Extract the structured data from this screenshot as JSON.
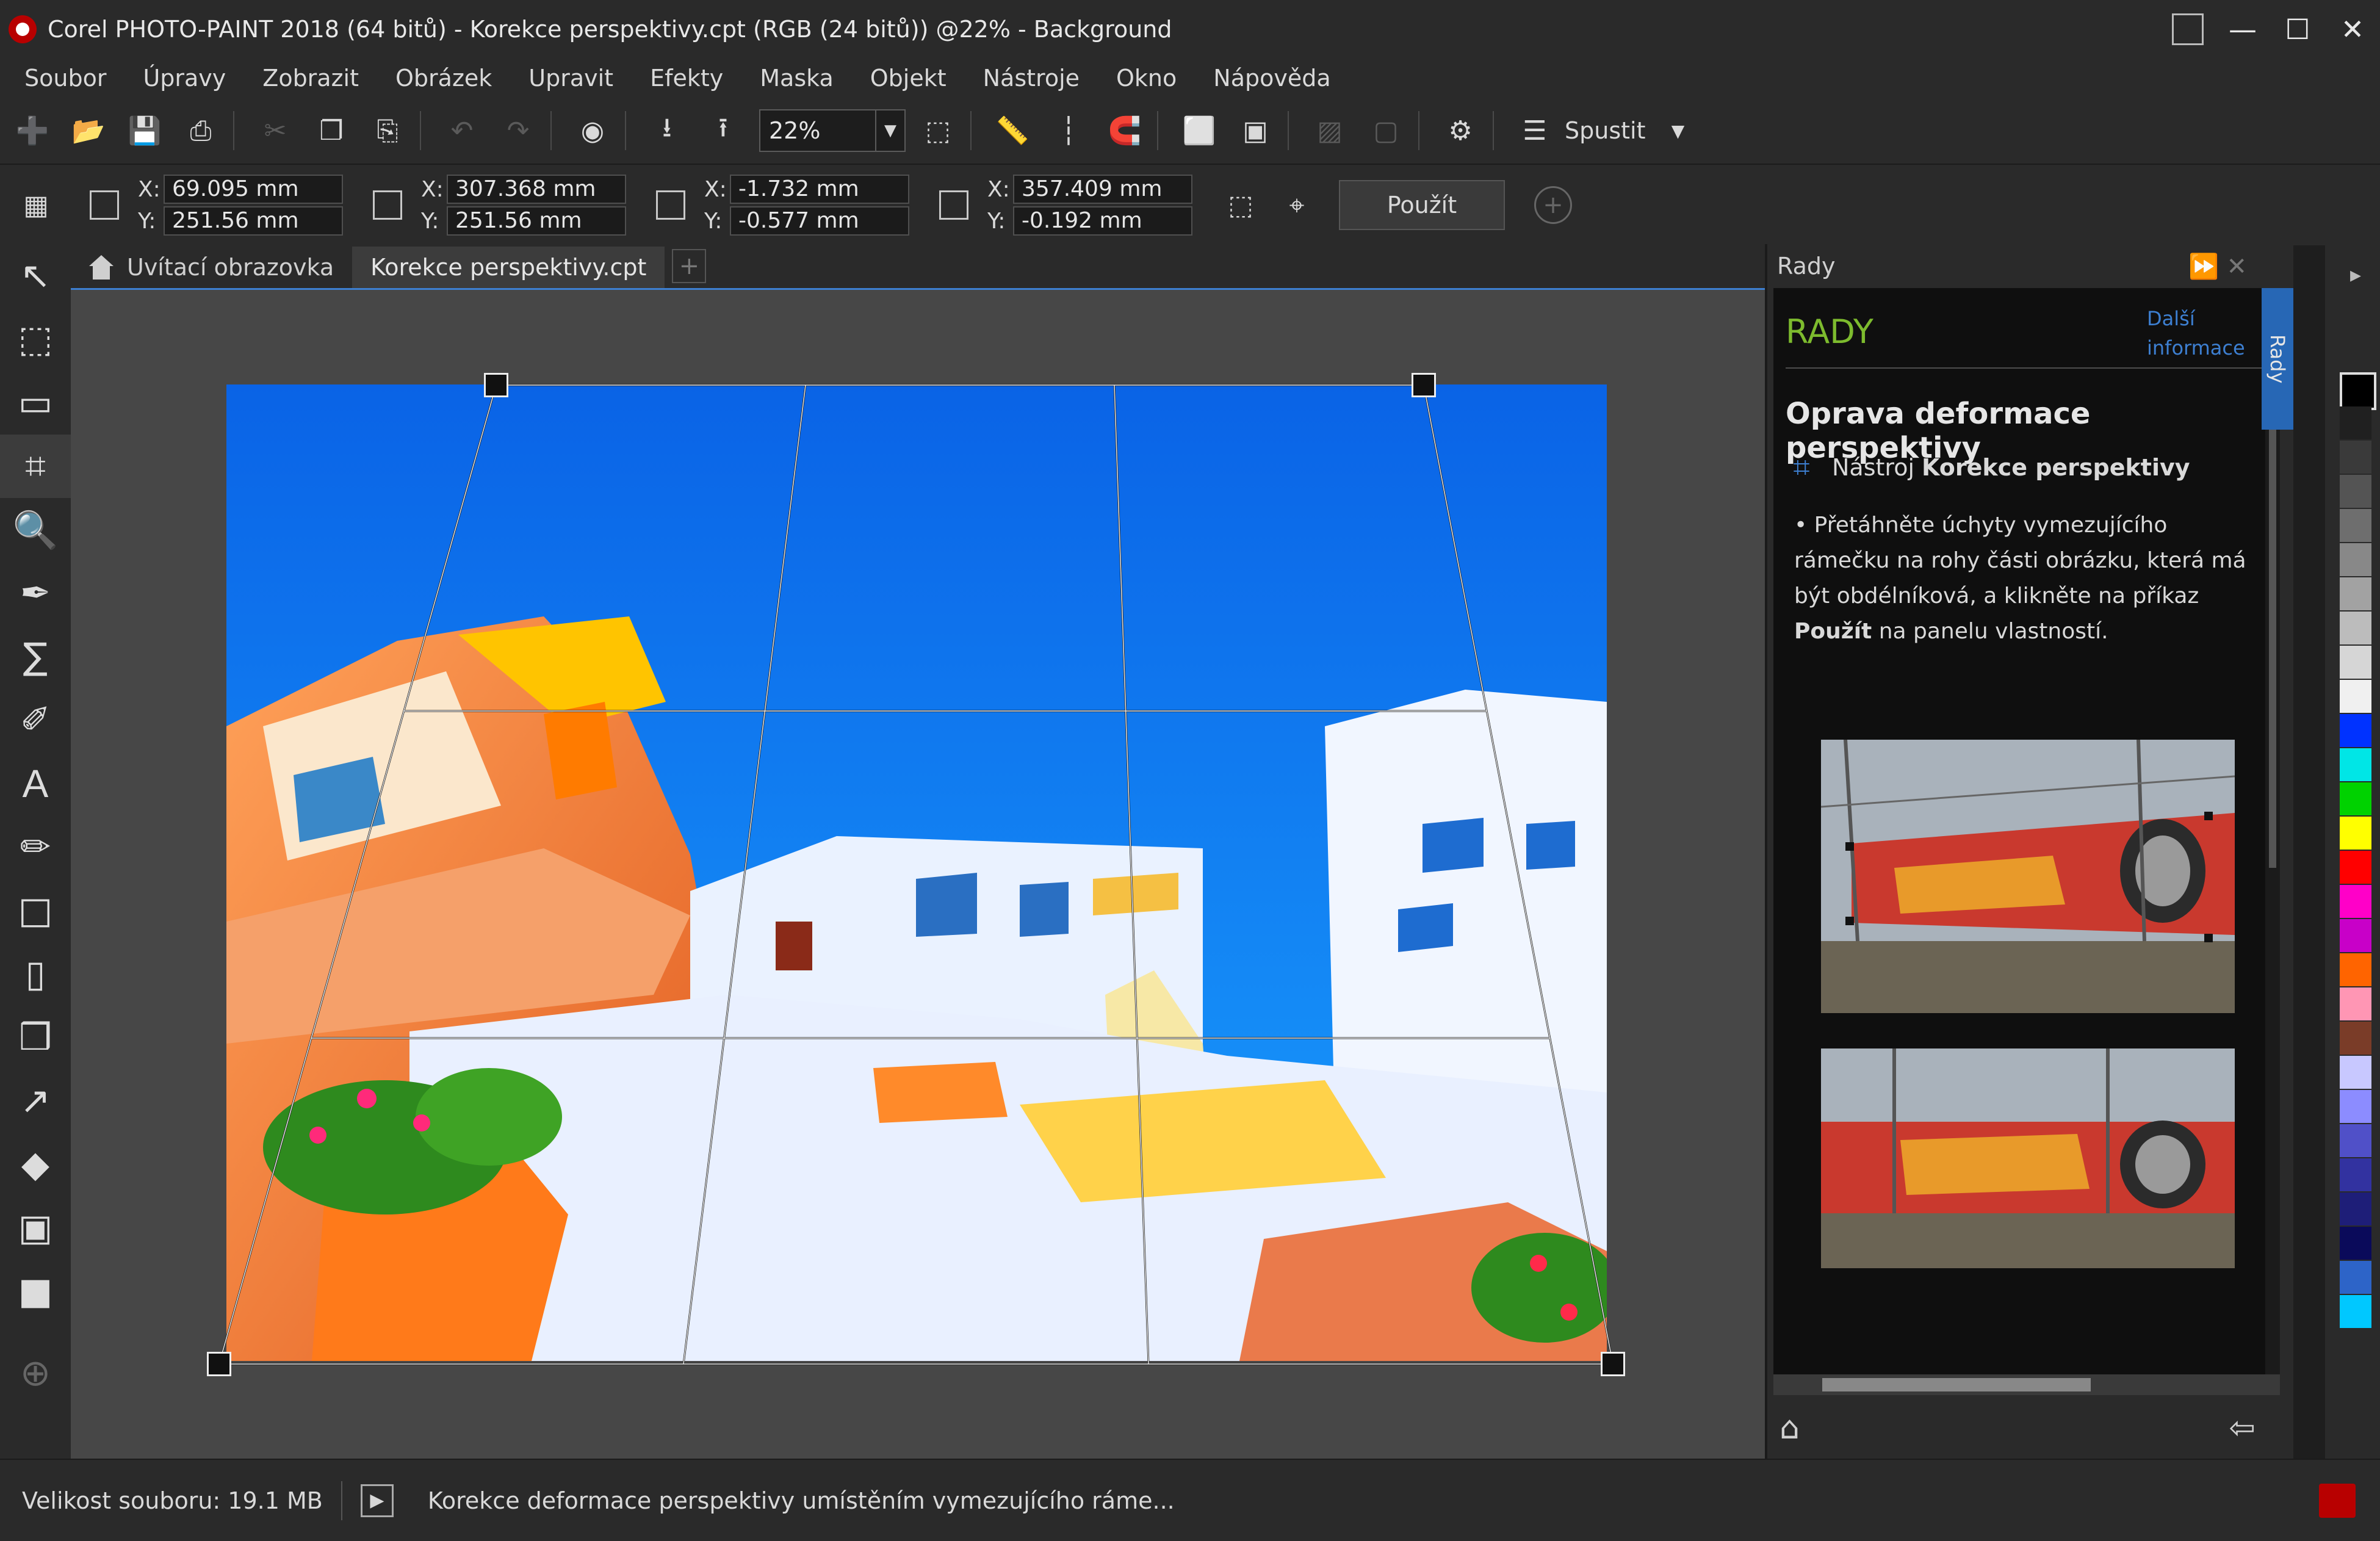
{
  "window": {
    "title": "Corel PHOTO-PAINT 2018 (64 bitů) - Korekce perspektivy.cpt (RGB (24 bitů)) @22% - Background",
    "controls": [
      "—",
      "☐",
      "✕"
    ]
  },
  "menu": [
    "Soubor",
    "Úpravy",
    "Zobrazit",
    "Obrázek",
    "Upravit",
    "Efekty",
    "Maska",
    "Objekt",
    "Nástroje",
    "Okno",
    "Nápověda"
  ],
  "toolbar": {
    "zoom": "22%",
    "spustit": "Spustit"
  },
  "properties": {
    "groups": [
      {
        "x": "69.095 mm",
        "y": "251.56 mm"
      },
      {
        "x": "307.368 mm",
        "y": "251.56 mm"
      },
      {
        "x": "-1.732 mm",
        "y": "-0.577 mm"
      },
      {
        "x": "357.409 mm",
        "y": "-0.192 mm"
      }
    ],
    "x_label": "X:",
    "y_label": "Y:",
    "apply": "Použít"
  },
  "tabs": {
    "welcome": "Uvítací obrazovka",
    "doc": "Korekce perspektivy.cpt"
  },
  "hints": {
    "panel_title": "Rady",
    "heading": "RADY",
    "more": "Další informace",
    "title": "Oprava deformace perspektivy",
    "tool_prefix": "Nástroj",
    "tool_name": "Korekce perspektivy",
    "text_a": "• Přetáhněte úchyty vymezujícího rámečku na rohy části obrázku, která má být obdélníková, a klikněte na příkaz",
    "text_bold": "Použít",
    "text_b": "na panelu vlastností.",
    "side_tab": "Rady"
  },
  "palette": [
    "#000000",
    "#202020",
    "#3a3a3a",
    "#545454",
    "#6e6e6e",
    "#888888",
    "#a2a2a2",
    "#bcbcbc",
    "#d6d6d6",
    "#f0f0f0",
    "#0032ff",
    "#00e6e6",
    "#00d200",
    "#ffff00",
    "#ff0000",
    "#ff00c8",
    "#c800c8",
    "#ff6400",
    "#ff96b4",
    "#7a3c28",
    "#c8c8ff",
    "#8c8cff",
    "#5050c8",
    "#3232a0",
    "#1e1e78",
    "#0a0a5a",
    "#2d64c8",
    "#00c8ff"
  ],
  "status": {
    "size": "Velikost souboru: 19.1 MB",
    "message": "Korekce deformace perspektivy umístěním vymezujícího ráme..."
  }
}
